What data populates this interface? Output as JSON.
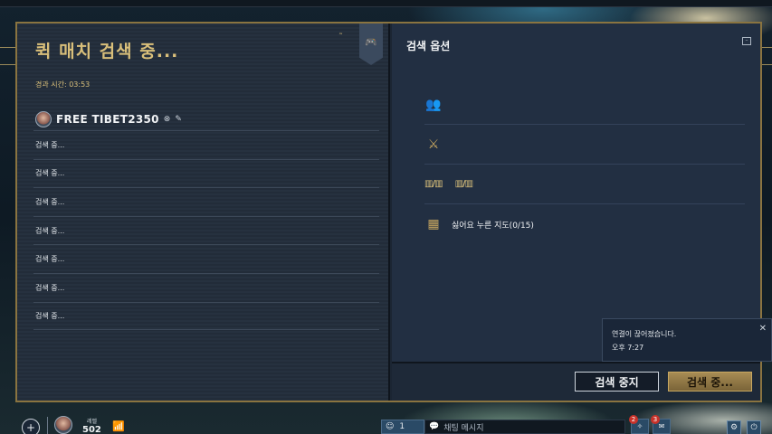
{
  "header": {
    "title": "퀵 매치 검색 중...",
    "elapsed_label": "경과 시간: 03:53"
  },
  "player": {
    "name": "FREE TIBET2350"
  },
  "slots": [
    {
      "label": "검색 중..."
    },
    {
      "label": "검색 중..."
    },
    {
      "label": "검색 중..."
    },
    {
      "label": "검색 중..."
    },
    {
      "label": "검색 중..."
    },
    {
      "label": "검색 중..."
    },
    {
      "label": "검색 중..."
    }
  ],
  "options": {
    "title": "검색 옵션",
    "ratio_a": "▥/▥",
    "ratio_b": "▥/▥",
    "disliked_maps": "싫어요 누른 지도(0/15)"
  },
  "buttons": {
    "stop_search": "검색 중지",
    "searching": "검색 중..."
  },
  "toast": {
    "message": "연결이 끊어졌습니다.",
    "time": "오후 7:27"
  },
  "bottom": {
    "level_label": "레벨",
    "level_value": "502",
    "friends_count": "1",
    "chat_placeholder": "채팅 메시지",
    "notif_1_count": "2",
    "notif_2_count": "3"
  },
  "colors": {
    "accent_gold": "#d9bf7a",
    "panel_dark": "#222f42",
    "frame_border": "#8a7440"
  }
}
